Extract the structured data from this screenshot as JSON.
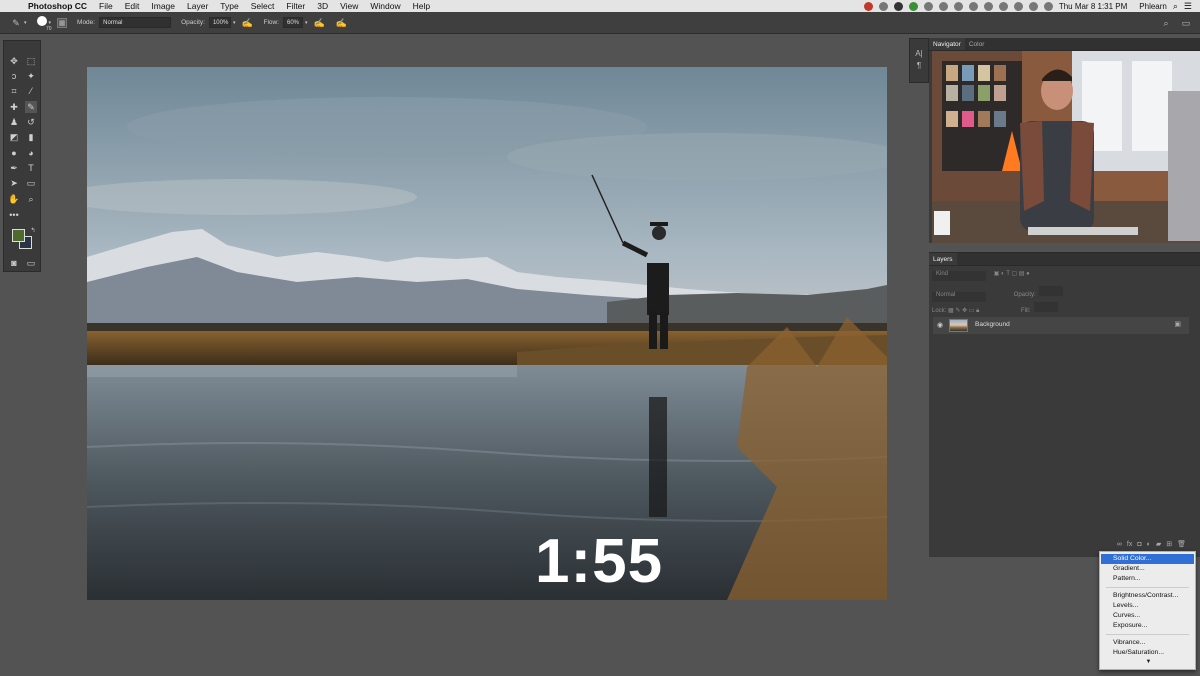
{
  "menubar": {
    "app_name": "Photoshop CC",
    "items": [
      "File",
      "Edit",
      "Image",
      "Layer",
      "Type",
      "Select",
      "Filter",
      "3D",
      "View",
      "Window",
      "Help"
    ],
    "clock": "Thu Mar 8  1:31 PM",
    "user": "Phlearn"
  },
  "options_bar": {
    "brush_size": "70",
    "mode_label": "Mode:",
    "mode_value": "Normal",
    "opacity_label": "Opacity:",
    "opacity_value": "100%",
    "flow_label": "Flow:",
    "flow_value": "60%"
  },
  "canvas": {
    "timer": "1:55"
  },
  "colors": {
    "foreground": "#4e6a2e",
    "background": "#2a3445",
    "menu_highlight": "#2f6fd6"
  },
  "navigator": {
    "tabs": [
      "Navigator",
      "Color"
    ]
  },
  "layers": {
    "title": "Layers",
    "kind_placeholder": "Kind",
    "blend_mode": "Normal",
    "opacity_label": "Opacity:",
    "lock_label": "Lock:",
    "fill_label": "Fill:",
    "layer_name": "Background"
  },
  "adjustment_menu": {
    "group1": [
      "Solid Color...",
      "Gradient...",
      "Pattern..."
    ],
    "group2": [
      "Brightness/Contrast...",
      "Levels...",
      "Curves...",
      "Exposure..."
    ],
    "group3": [
      "Vibrance...",
      "Hue/Saturation..."
    ],
    "selected": "Solid Color..."
  }
}
